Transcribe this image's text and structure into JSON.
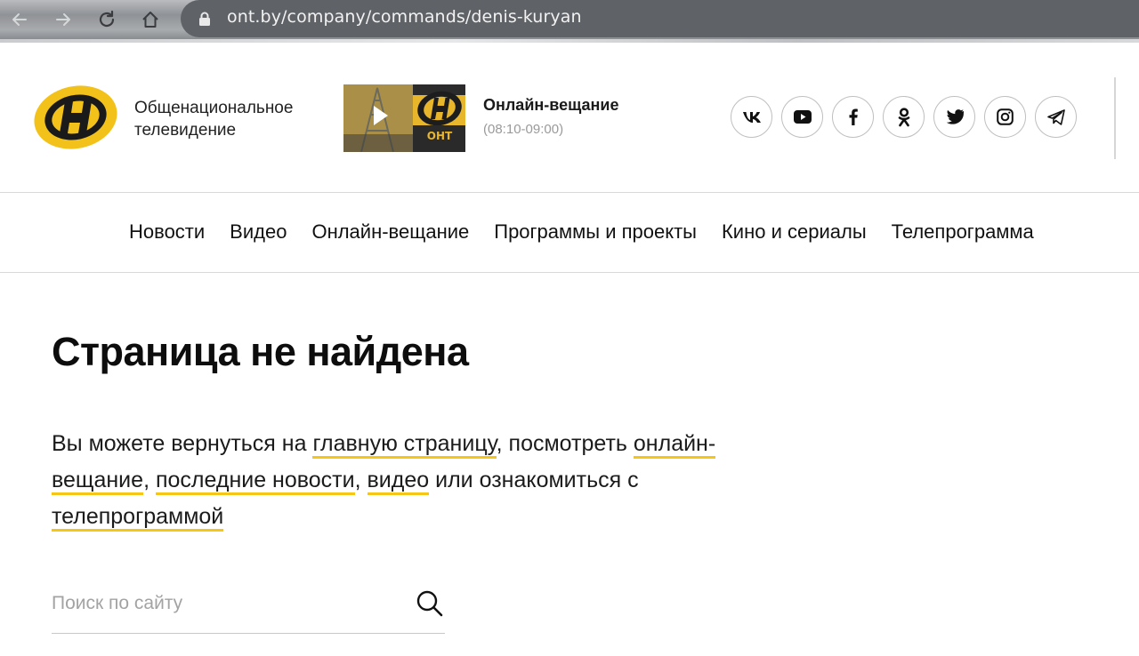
{
  "browser": {
    "url": "ont.by/company/commands/denis-kuryan"
  },
  "header": {
    "brand_line1": "Общенациональное",
    "brand_line2": "телевидение",
    "live": {
      "title": "Онлайн-вещание",
      "time": "(08:10-09:00)"
    },
    "social_icons": [
      "vk-icon",
      "youtube-icon",
      "facebook-icon",
      "odnoklassniki-icon",
      "twitter-icon",
      "instagram-icon",
      "telegram-icon"
    ]
  },
  "menu": {
    "items": [
      "Новости",
      "Видео",
      "Онлайн-вещание",
      "Программы и проекты",
      "Кино и сериалы",
      "Телепрограмма"
    ]
  },
  "main": {
    "title": "Страница не найдена",
    "text_1": "Вы можете вернуться на ",
    "link_home": "главную страницу",
    "text_2": ", посмотреть ",
    "link_live": "онлайн-вещание",
    "text_3": ", ",
    "link_news": "последние новости",
    "text_4": ", ",
    "link_video": "видео",
    "text_5": " или ознакомиться с ",
    "link_tv": "телепрограммой"
  },
  "search": {
    "placeholder": "Поиск по сайту"
  },
  "colors": {
    "accent": "#f5c518",
    "logo_yellow": "#f2c21b"
  }
}
